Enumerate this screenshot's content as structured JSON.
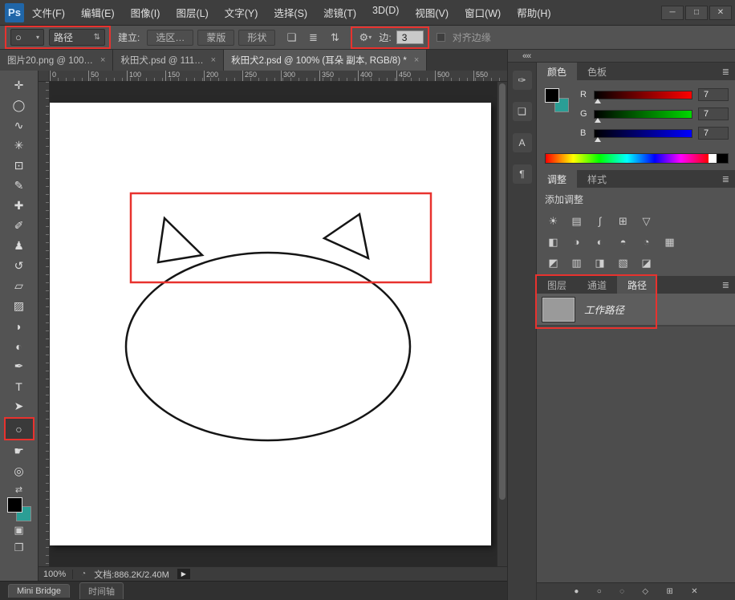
{
  "colors": {
    "highlight": "#e8322e",
    "bg_teal": "#2b9e95"
  },
  "titlebar": {
    "logo": "Ps",
    "menus": [
      "文件(F)",
      "编辑(E)",
      "图像(I)",
      "图层(L)",
      "文字(Y)",
      "选择(S)",
      "滤镜(T)",
      "3D(D)",
      "视图(V)",
      "窗口(W)",
      "帮助(H)"
    ],
    "window_controls": [
      {
        "name": "minimize-button",
        "glyph": "─"
      },
      {
        "name": "maximize-button",
        "glyph": "□"
      },
      {
        "name": "close-button",
        "glyph": "✕"
      }
    ]
  },
  "options_bar": {
    "tool_icon": "○",
    "mode_value": "路径",
    "make_label": "建立:",
    "make_buttons": [
      {
        "name": "make-selection-button",
        "label": "选区…"
      },
      {
        "name": "make-mask-button",
        "label": "蒙版"
      },
      {
        "name": "make-shape-button",
        "label": "形状"
      }
    ],
    "op_icons": [
      {
        "name": "path-operations-icon",
        "glyph": "❏"
      },
      {
        "name": "path-alignment-icon",
        "glyph": "≣"
      },
      {
        "name": "path-arrange-icon",
        "glyph": "⇅"
      }
    ],
    "gear_icon": "⚙",
    "sides_label": "边:",
    "sides_value": "3",
    "align_edges_label": "对齐边缘"
  },
  "tabs": [
    {
      "label": "图片20.png @ 100…",
      "close": "×"
    },
    {
      "label": "秋田犬.psd @ 111…",
      "close": "×"
    },
    {
      "label": "秋田犬2.psd @ 100% (耳朵 副本, RGB/8) *",
      "close": "×"
    }
  ],
  "toolbar": {
    "tools_before": [
      {
        "name": "move-tool",
        "glyph": "✛"
      },
      {
        "name": "elliptical-marquee-tool",
        "glyph": "◯"
      },
      {
        "name": "lasso-tool",
        "glyph": "∿"
      },
      {
        "name": "quick-selection-tool",
        "glyph": "✳"
      },
      {
        "name": "crop-tool",
        "glyph": "⊡"
      },
      {
        "name": "eyedropper-tool",
        "glyph": "✎"
      },
      {
        "name": "healing-brush-tool",
        "glyph": "✚"
      },
      {
        "name": "brush-tool",
        "glyph": "✐"
      },
      {
        "name": "clone-stamp-tool",
        "glyph": "♟"
      },
      {
        "name": "history-brush-tool",
        "glyph": "↺"
      },
      {
        "name": "eraser-tool",
        "glyph": "▱"
      },
      {
        "name": "gradient-tool",
        "glyph": "▨"
      },
      {
        "name": "blur-tool",
        "glyph": "◗"
      },
      {
        "name": "dodge-tool",
        "glyph": "◐"
      },
      {
        "name": "pen-tool",
        "glyph": "✒"
      },
      {
        "name": "type-tool",
        "glyph": "T"
      },
      {
        "name": "path-selection-tool",
        "glyph": "➤"
      }
    ],
    "ellipse_tool": {
      "name": "ellipse-tool",
      "glyph": "○"
    },
    "tools_after": [
      {
        "name": "hand-tool",
        "glyph": "☛"
      },
      {
        "name": "zoom-tool",
        "glyph": "◎"
      }
    ],
    "swap_icon": "⇄",
    "quick_mask_icon": "▣",
    "screen_mode_icon": "❐"
  },
  "ruler": {
    "h_ticks": [
      "0",
      "50",
      "100",
      "150",
      "200",
      "250",
      "300",
      "350",
      "400",
      "450",
      "500",
      "550"
    ]
  },
  "status_bar": {
    "zoom": "100%",
    "preview_icon": "◔",
    "doc_info": "文档:886.2K/2.40M",
    "expand_icon": "▶"
  },
  "bottom_bar": {
    "mini_bridge": "Mini Bridge",
    "timeline": "时间轴"
  },
  "dock_strip": {
    "collapse_icon": "««",
    "icons": [
      {
        "name": "brush-panel-icon",
        "glyph": "✑"
      },
      {
        "name": "clone-source-panel-icon",
        "glyph": "❏"
      },
      {
        "name": "character-panel-icon",
        "glyph": "A"
      },
      {
        "name": "paragraph-panel-icon",
        "glyph": "¶"
      }
    ]
  },
  "color_panel": {
    "tabs": [
      {
        "label": "颜色"
      },
      {
        "label": "色板"
      }
    ],
    "menu_icon": "≣",
    "sliders": [
      {
        "label": "R",
        "value": "7"
      },
      {
        "label": "G",
        "value": "7"
      },
      {
        "label": "B",
        "value": "7"
      }
    ]
  },
  "adjustments_panel": {
    "tabs": [
      {
        "label": "调整"
      },
      {
        "label": "样式"
      }
    ],
    "menu_icon": "≣",
    "title": "添加调整",
    "row1": [
      {
        "name": "brightness-contrast-icon",
        "glyph": "☀"
      },
      {
        "name": "levels-icon",
        "glyph": "▤"
      },
      {
        "name": "curves-icon",
        "glyph": "∫"
      },
      {
        "name": "exposure-icon",
        "glyph": "⊞"
      },
      {
        "name": "vibrance-icon",
        "glyph": "▽"
      }
    ],
    "row2": [
      {
        "name": "hue-saturation-icon",
        "glyph": "◧"
      },
      {
        "name": "color-balance-icon",
        "glyph": "◑"
      },
      {
        "name": "black-white-icon",
        "glyph": "◐"
      },
      {
        "name": "photo-filter-icon",
        "glyph": "◓"
      },
      {
        "name": "channel-mixer-icon",
        "glyph": "◔"
      },
      {
        "name": "color-lookup-icon",
        "glyph": "▦"
      }
    ],
    "row3": [
      {
        "name": "invert-icon",
        "glyph": "◩"
      },
      {
        "name": "posterize-icon",
        "glyph": "▥"
      },
      {
        "name": "threshold-icon",
        "glyph": "◨"
      },
      {
        "name": "gradient-map-icon",
        "glyph": "▧"
      },
      {
        "name": "selective-color-icon",
        "glyph": "◪"
      }
    ]
  },
  "paths_panel": {
    "tabs": [
      {
        "label": "图层"
      },
      {
        "label": "通道"
      },
      {
        "label": "路径"
      }
    ],
    "menu_icon": "≣",
    "work_path_label": "工作路径"
  },
  "panel_footer": {
    "icons": [
      {
        "name": "fill-path-icon",
        "glyph": "●"
      },
      {
        "name": "stroke-path-icon",
        "glyph": "○"
      },
      {
        "name": "load-path-selection-icon",
        "glyph": "◌"
      },
      {
        "name": "make-work-path-icon",
        "glyph": "◇"
      },
      {
        "name": "new-path-icon",
        "glyph": "⊞"
      },
      {
        "name": "delete-path-icon",
        "glyph": "✕"
      }
    ]
  }
}
